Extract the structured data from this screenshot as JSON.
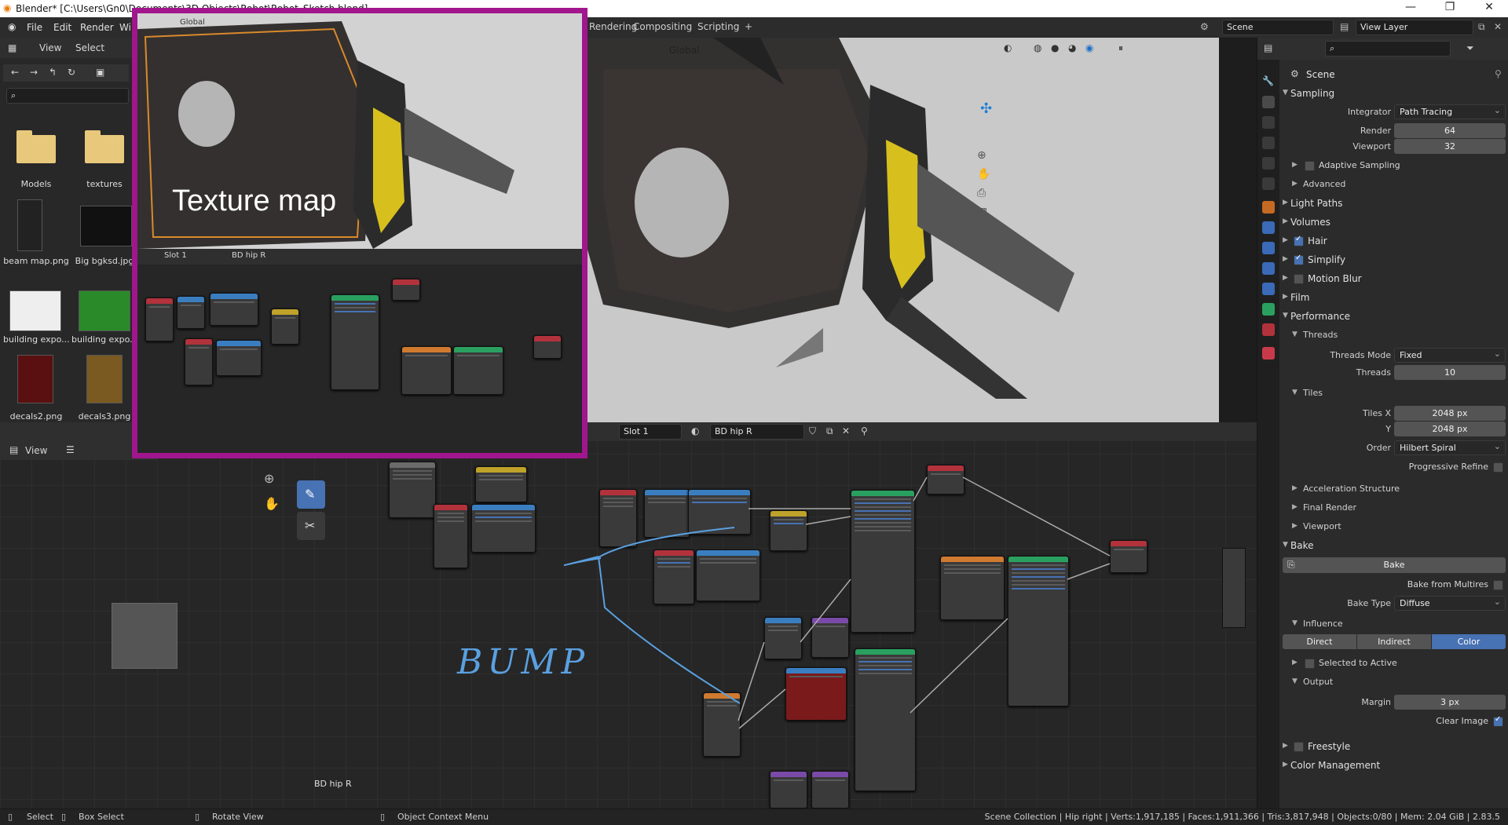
{
  "window": {
    "title": "Blender* [C:\\Users\\Gn0\\Documents\\3D Objects\\Robot\\Robot_Sketch.blend]",
    "min_glyph": "—",
    "max_glyph": "❐",
    "close_glyph": "✕"
  },
  "topbar": {
    "menus": [
      "File",
      "Edit",
      "Render",
      "Wi"
    ],
    "workspace_tabs": [
      "Rendering",
      "Compositing",
      "Scripting",
      "+"
    ],
    "scene_label": "Scene",
    "view_layer_label": "View Layer"
  },
  "file_browser": {
    "header_items": [
      "View",
      "Select"
    ],
    "items": [
      {
        "label": "Models",
        "kind": "folder"
      },
      {
        "label": "textures",
        "kind": "folder"
      },
      {
        "label": "beam map.png",
        "kind": "image"
      },
      {
        "label": "Big bgksd.jpg",
        "kind": "image"
      },
      {
        "label": "building expo...",
        "kind": "image"
      },
      {
        "label": "building expo...",
        "kind": "image"
      },
      {
        "label": "decals2.png",
        "kind": "image"
      },
      {
        "label": "decals3.png",
        "kind": "image"
      }
    ]
  },
  "viewport": {
    "orientation": "Global"
  },
  "node_editor": {
    "slot": "Slot 1",
    "material": "BD hip R",
    "view_label": "View",
    "footer_label": "BD hip R",
    "annotation": "BUMP"
  },
  "inset": {
    "caption": "Texture map",
    "orientation": "Global",
    "slot": "Slot 1",
    "material": "BD hip R"
  },
  "properties": {
    "header": "Scene",
    "search_placeholder": "",
    "sampling": {
      "title": "Sampling",
      "integrator_label": "Integrator",
      "integrator_value": "Path Tracing",
      "render_label": "Render",
      "render_value": "64",
      "viewport_label": "Viewport",
      "viewport_value": "32",
      "adaptive_label": "Adaptive Sampling",
      "advanced_label": "Advanced"
    },
    "light_paths": "Light Paths",
    "volumes": "Volumes",
    "hair": "Hair",
    "simplify": "Simplify",
    "motion_blur": "Motion Blur",
    "film": "Film",
    "performance": {
      "title": "Performance",
      "threads_title": "Threads",
      "threads_mode_label": "Threads Mode",
      "threads_mode_value": "Fixed",
      "threads_label": "Threads",
      "threads_value": "10",
      "tiles_title": "Tiles",
      "tiles_x_label": "Tiles X",
      "tiles_x_value": "2048 px",
      "tiles_y_label": "Y",
      "tiles_y_value": "2048 px",
      "order_label": "Order",
      "order_value": "Hilbert Spiral",
      "progressive_label": "Progressive Refine",
      "accel_label": "Acceleration Structure",
      "final_render_label": "Final Render",
      "viewport_label": "Viewport"
    },
    "bake": {
      "title": "Bake",
      "bake_button": "Bake",
      "from_multires_label": "Bake from Multires",
      "bake_type_label": "Bake Type",
      "bake_type_value": "Diffuse",
      "influence_title": "Influence",
      "direct": "Direct",
      "indirect": "Indirect",
      "color": "Color",
      "selected_active_label": "Selected to Active",
      "output_title": "Output",
      "margin_label": "Margin",
      "margin_value": "3 px",
      "clear_image_label": "Clear Image"
    },
    "freestyle": "Freestyle",
    "color_management": "Color Management"
  },
  "statusbar": {
    "select": "Select",
    "box_select": "Box Select",
    "rotate_view": "Rotate View",
    "context_menu": "Object Context Menu",
    "stats": "Scene Collection | Hip right | Verts:1,917,185 | Faces:1,911,366 | Tris:3,817,948 | Objects:0/80 | Mem: 2.04 GiB | 2.83.5"
  },
  "colors": {
    "accent": "#4772b3",
    "inset_border": "#a1168d",
    "annotation": "#5aa0e0"
  }
}
